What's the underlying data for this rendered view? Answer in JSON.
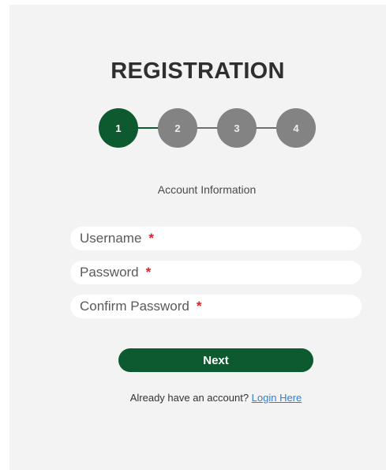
{
  "form": {
    "title": "REGISTRATION",
    "steps": [
      {
        "number": "1",
        "active": true
      },
      {
        "number": "2",
        "active": false
      },
      {
        "number": "3",
        "active": false
      },
      {
        "number": "4",
        "active": false
      }
    ],
    "step_caption": "Account Information",
    "fields": {
      "username": {
        "label": "Username",
        "required_mark": "*",
        "value": ""
      },
      "password": {
        "label": "Password",
        "required_mark": "*",
        "value": ""
      },
      "confirm_password": {
        "label": "Confirm Password",
        "required_mark": "*",
        "value": ""
      }
    },
    "next_label": "Next",
    "login_prompt": "Already have an account?",
    "login_link": "Login Here"
  },
  "colors": {
    "accent": "#0d5a30",
    "inactive_step": "#838383",
    "card_background": "#f3f3f3",
    "required": "#e02020",
    "link": "#2f7fd6"
  },
  "icons": []
}
